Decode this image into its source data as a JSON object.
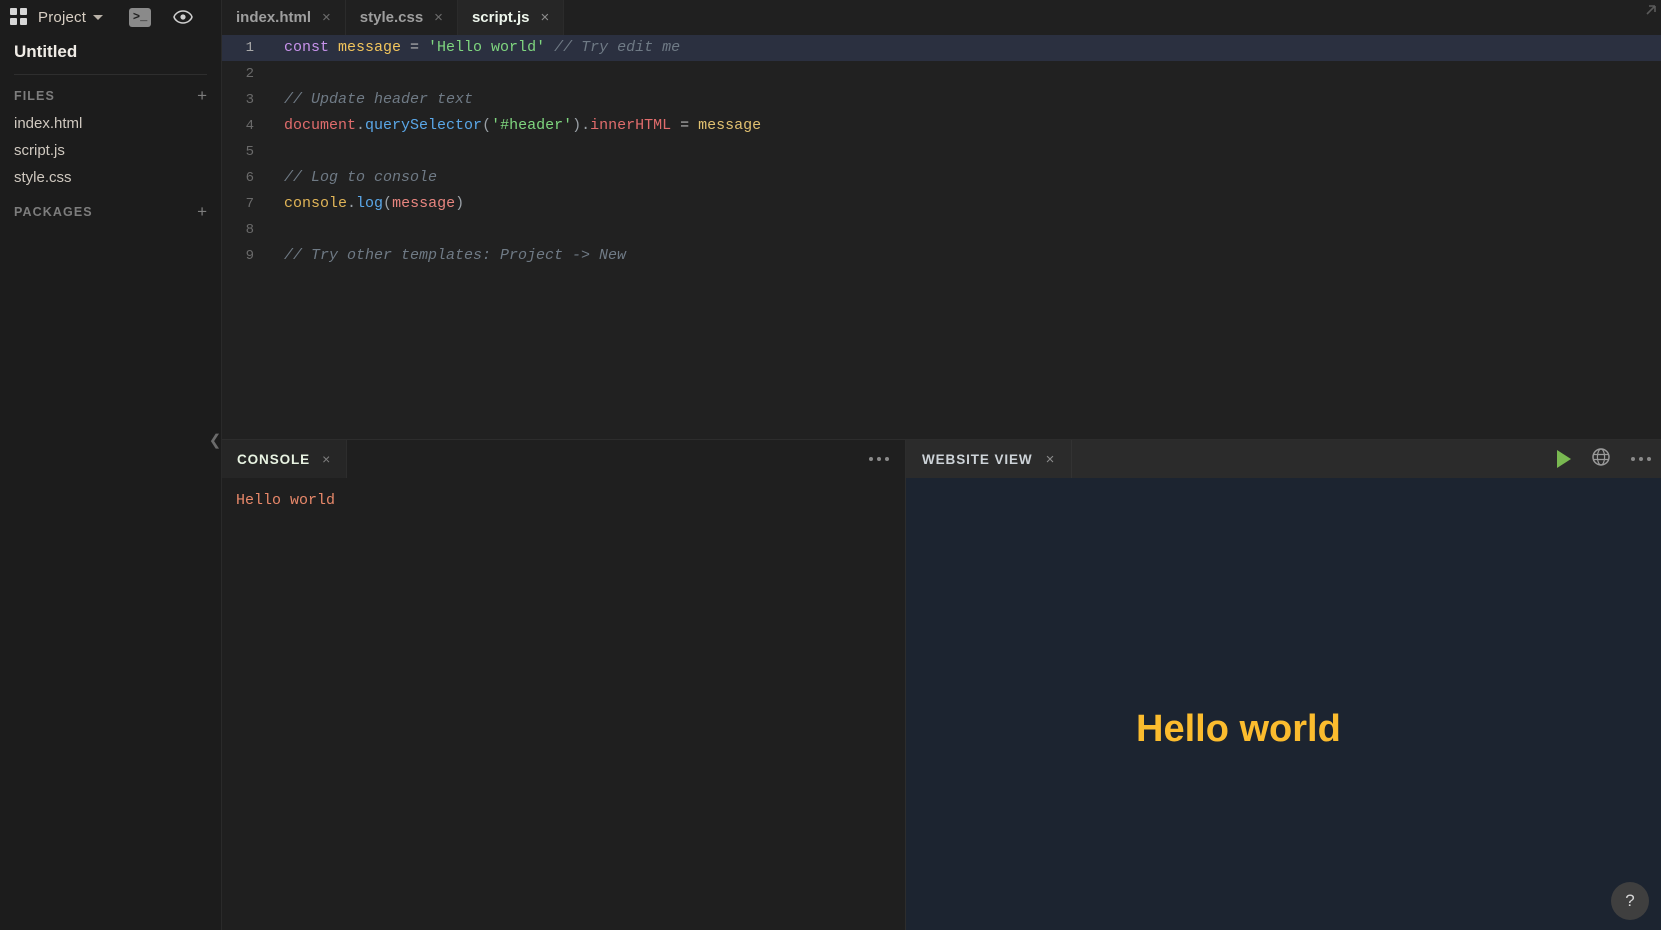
{
  "sidebar": {
    "project_label": "Project",
    "icons": {
      "grid": "grid-icon",
      "terminal": "terminal-icon",
      "eye": "eye-icon",
      "caret": "chevron-down-icon"
    },
    "untitled": "Untitled",
    "files_section": {
      "label": "FILES",
      "add": "+"
    },
    "files": [
      {
        "name": "index.html"
      },
      {
        "name": "script.js"
      },
      {
        "name": "style.css"
      }
    ],
    "packages_section": {
      "label": "PACKAGES",
      "add": "+"
    }
  },
  "tabs": [
    {
      "label": "index.html",
      "close": "×",
      "active": false
    },
    {
      "label": "style.css",
      "close": "×",
      "active": false
    },
    {
      "label": "script.js",
      "close": "×",
      "active": true
    }
  ],
  "editor": {
    "active_file": "script.js",
    "line_numbers": [
      "1",
      "2",
      "3",
      "4",
      "5",
      "6",
      "7",
      "8",
      "9"
    ],
    "lines": [
      {
        "n": "1",
        "highlight": true,
        "raw": "const message = 'Hello world' // Try edit me"
      },
      {
        "n": "2",
        "highlight": false,
        "raw": ""
      },
      {
        "n": "3",
        "highlight": false,
        "raw": "// Update header text"
      },
      {
        "n": "4",
        "highlight": false,
        "raw": "document.querySelector('#header').innerHTML = message"
      },
      {
        "n": "5",
        "highlight": false,
        "raw": ""
      },
      {
        "n": "6",
        "highlight": false,
        "raw": "// Log to console"
      },
      {
        "n": "7",
        "highlight": false,
        "raw": "console.log(message)"
      },
      {
        "n": "8",
        "highlight": false,
        "raw": ""
      },
      {
        "n": "9",
        "highlight": false,
        "raw": "// Try other templates: Project -> New"
      }
    ],
    "tok": {
      "l1_const": "const",
      "l1_name": " message",
      "l1_eq": " = ",
      "l1_str": "'Hello world'",
      "l1_com": " // Try edit me",
      "l3_com": "// Update header text",
      "l4_doc": "document",
      "l4_dot1": ".",
      "l4_qs": "querySelector",
      "l4_open": "(",
      "l4_str": "'#header'",
      "l4_close": ")",
      "l4_dot2": ".",
      "l4_inner": "innerHTML",
      "l4_eq": " = ",
      "l4_msg": "message",
      "l6_com": "// Log to console",
      "l7_console": "console",
      "l7_dot": ".",
      "l7_log": "log",
      "l7_open": "(",
      "l7_msg": "message",
      "l7_close": ")",
      "l9_com": "// Try other templates: Project -> New"
    }
  },
  "console_panel": {
    "tab_label": "CONSOLE",
    "close": "×",
    "menu": "more-options",
    "output": [
      "Hello world"
    ]
  },
  "website_panel": {
    "tab_label": "WEBSITE VIEW",
    "close": "×",
    "run_icon": "play-icon",
    "open_icon": "globe-icon",
    "menu_icon": "more-options-icon",
    "heading": "Hello world"
  },
  "help": {
    "label": "?"
  },
  "colors": {
    "accent_yellow": "#fbbc2e",
    "play_green": "#79b851",
    "website_bg": "#1c2430",
    "console_text": "#e8886a",
    "editor_bg": "#212121",
    "highlight_line": "#2b3040"
  }
}
